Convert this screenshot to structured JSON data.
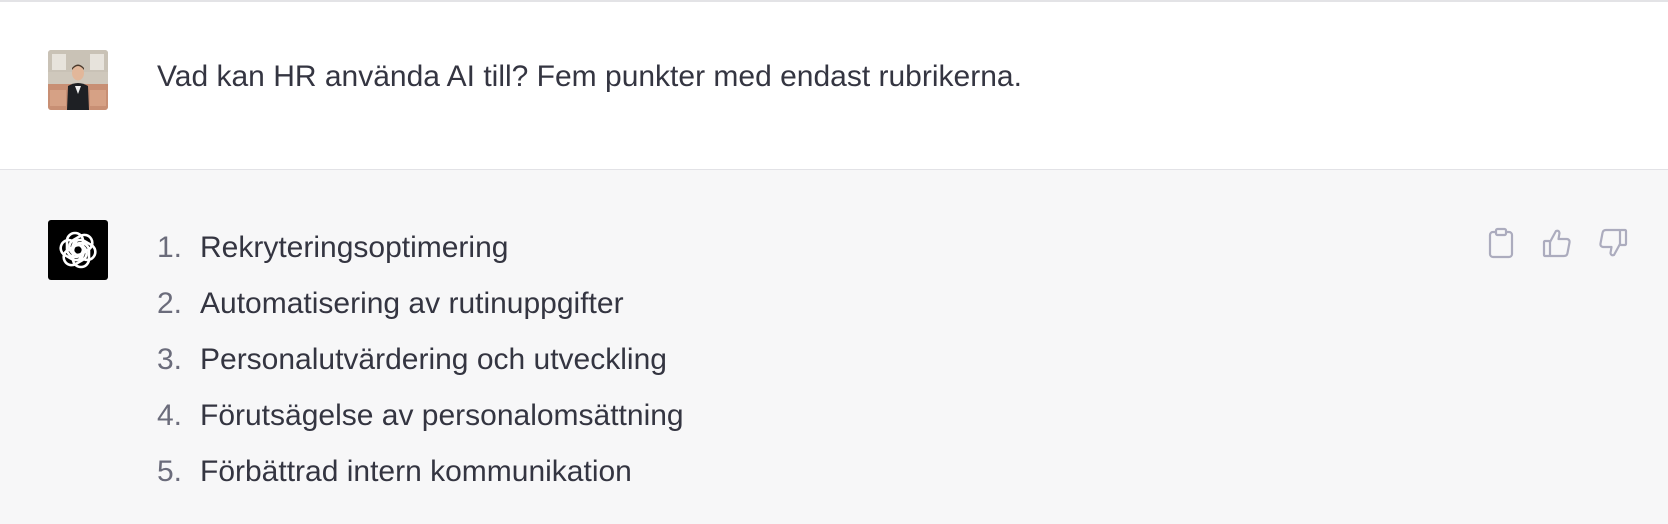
{
  "user_message": {
    "avatar_icon": "user-photo-avatar",
    "text": "Vad kan HR använda AI till? Fem punkter med endast rubrikerna."
  },
  "assistant_message": {
    "avatar_icon": "openai-logo-icon",
    "items": [
      {
        "num": "1.",
        "text": "Rekryteringsoptimering"
      },
      {
        "num": "2.",
        "text": "Automatisering av rutinuppgifter"
      },
      {
        "num": "3.",
        "text": "Personalutvärdering och utveckling"
      },
      {
        "num": "4.",
        "text": "Förutsägelse av personalomsättning"
      },
      {
        "num": "5.",
        "text": "Förbättrad intern kommunikation"
      }
    ],
    "actions": [
      "copy-icon",
      "thumbs-up-icon",
      "thumbs-down-icon"
    ]
  },
  "colors": {
    "text": "#343541",
    "assistant_bg": "#f7f7f8",
    "user_bg": "#ffffff",
    "icon": "#acacbe"
  }
}
